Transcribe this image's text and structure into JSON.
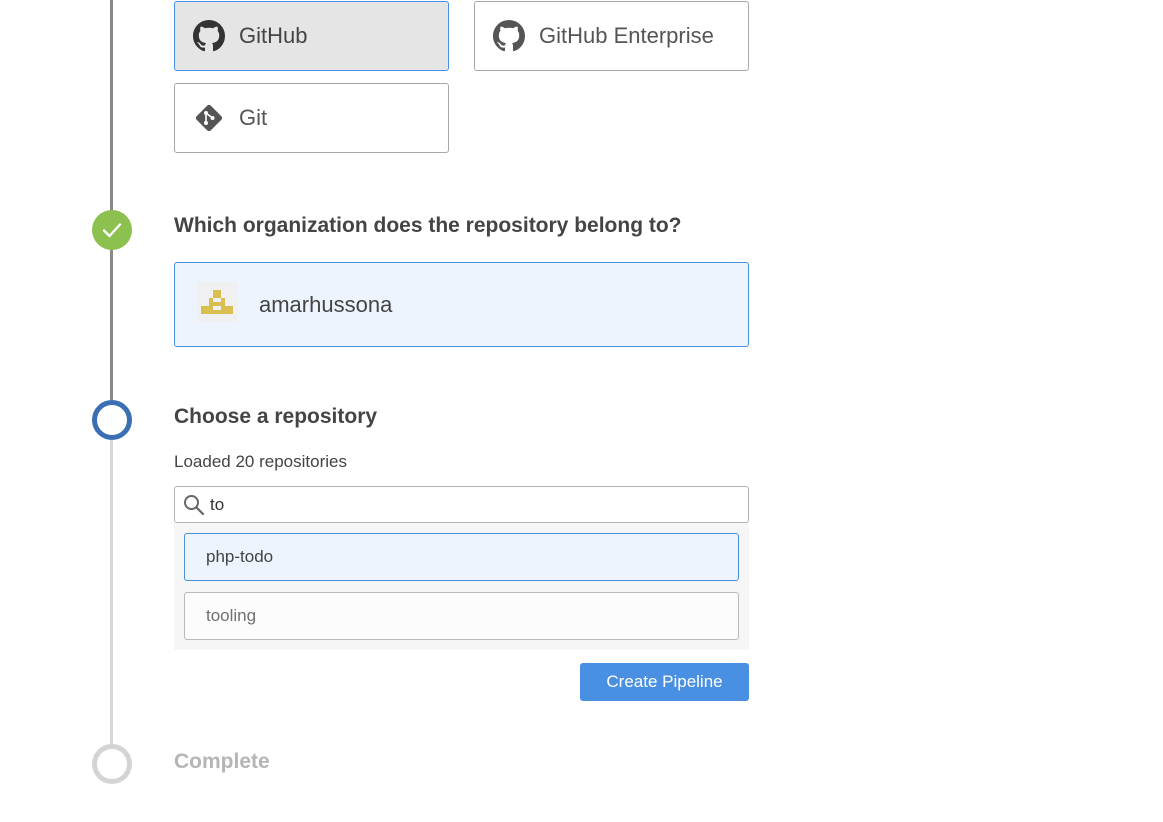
{
  "scm_options": [
    {
      "label": "GitHub",
      "icon": "github-icon",
      "selected": true
    },
    {
      "label": "GitHub Enterprise",
      "icon": "github-icon",
      "selected": false
    },
    {
      "label": "Git",
      "icon": "git-icon",
      "selected": false
    }
  ],
  "org_step": {
    "title": "Which organization does the repository belong to?",
    "status": "complete",
    "selected_org": {
      "name": "amarhussona",
      "avatar": "identicon-avatar"
    }
  },
  "repo_step": {
    "title": "Choose a repository",
    "status": "active",
    "loaded_text": "Loaded 20 repositories",
    "search": {
      "value": "to",
      "placeholder": ""
    },
    "repositories": [
      {
        "name": "php-todo",
        "selected": true
      },
      {
        "name": "tooling",
        "selected": false
      }
    ],
    "create_button": "Create Pipeline"
  },
  "complete_step": {
    "title": "Complete",
    "status": "pending"
  },
  "colors": {
    "accent": "#4a90e2",
    "success": "#8cc04f",
    "active_node": "#3a6fb6",
    "selected_bg": "#edf4fd"
  }
}
